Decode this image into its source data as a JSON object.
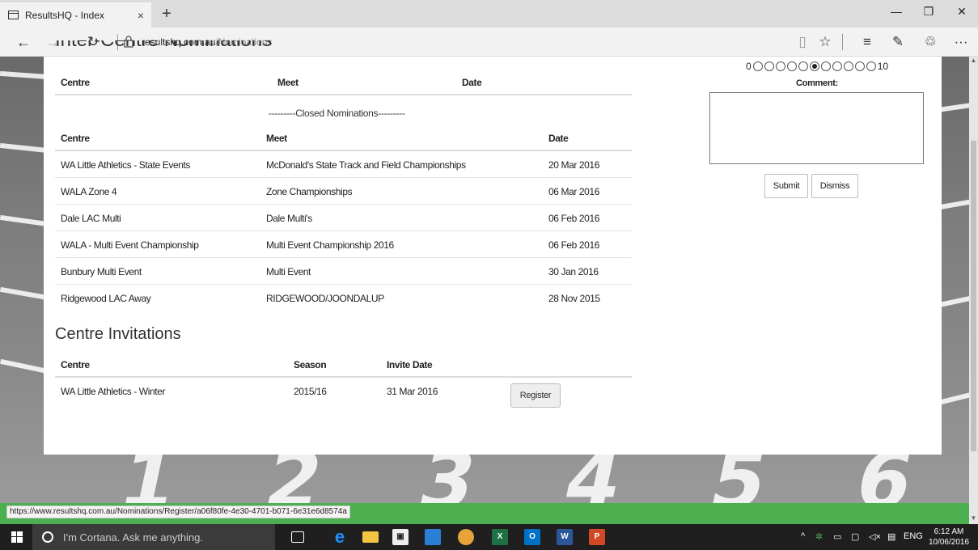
{
  "browser": {
    "tab_title": "ResultsHQ - Index",
    "tab_close": "×",
    "new_tab": "+",
    "url_domain": "resultshq.com.au",
    "url_path": "/Nominations",
    "minimize": "—",
    "maximize": "❐",
    "close": "✕",
    "more": "···"
  },
  "page": {
    "partial_heading": "Inter-Centre Nominations",
    "inter_centre_headers": {
      "centre": "Centre",
      "meet": "Meet",
      "date": "Date"
    },
    "closed_label": "---------Closed Nominations---------",
    "closed_headers": {
      "centre": "Centre",
      "meet": "Meet",
      "date": "Date"
    },
    "closed_rows": [
      {
        "centre": "WA Little Athletics - State Events",
        "meet": "McDonald's State Track and Field Championships",
        "date": "20 Mar 2016"
      },
      {
        "centre": "WALA Zone 4",
        "meet": "Zone Championships",
        "date": "06 Mar 2016"
      },
      {
        "centre": "Dale LAC Multi",
        "meet": "Dale Multi's",
        "date": "06 Feb 2016"
      },
      {
        "centre": "WALA - Multi Event Championship",
        "meet": "Multi Event Championship 2016",
        "date": "06 Feb 2016"
      },
      {
        "centre": "Bunbury Multi Event",
        "meet": "Multi Event",
        "date": "30 Jan 2016"
      },
      {
        "centre": "Ridgewood LAC Away",
        "meet": "RIDGEWOOD/JOONDALUP",
        "date": "28 Nov 2015"
      }
    ],
    "invitations_title": "Centre Invitations",
    "invitations_headers": {
      "centre": "Centre",
      "season": "Season",
      "invite_date": "Invite Date"
    },
    "invitation_rows": [
      {
        "centre": "WA Little Athletics - Winter",
        "season": "2015/16",
        "invite_date": "31 Mar 2016",
        "action": "Register"
      }
    ]
  },
  "feedback": {
    "rating_min": "0",
    "rating_max": "10",
    "rating_selected": 5,
    "comment_label": "Comment:",
    "submit": "Submit",
    "dismiss": "Dismiss"
  },
  "status_url": "https://www.resultshq.com.au/Nominations/Register/a06f80fe-4e30-4701-b071-6e31e6d8574a",
  "taskbar": {
    "cortana_placeholder": "I'm Cortana. Ask me anything.",
    "language": "ENG",
    "time": "6:12 AM",
    "date": "10/06/2016"
  },
  "background_lane_numbers": [
    "1",
    "2",
    "3",
    "4",
    "5",
    "6"
  ]
}
